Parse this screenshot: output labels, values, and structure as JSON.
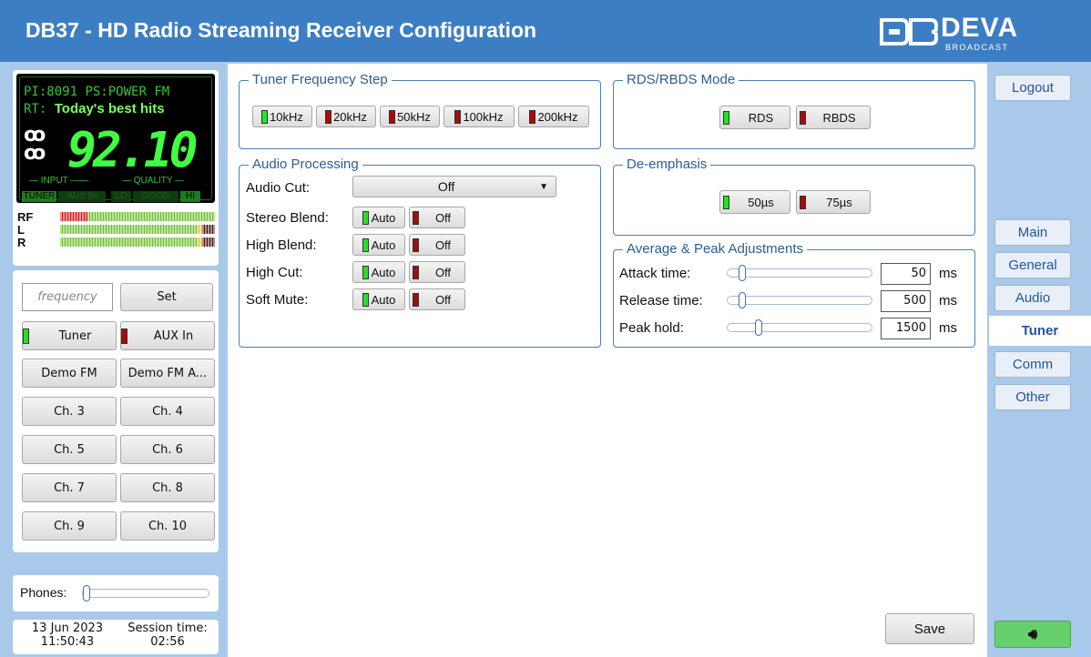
{
  "header": {
    "title": "DB37 - HD Radio Streaming Receiver Configuration",
    "logo_brand": "DEVA",
    "logo_sub": "BROADCAST"
  },
  "display": {
    "pi_label": "PI:",
    "pi_value": "8091",
    "ps_label": "PS:",
    "ps_value": "POWER FM",
    "rt_label": "RT:",
    "rt_value": "Today's best hits",
    "frequency": "92.10",
    "input_label": "INPUT",
    "quality_label": "QUALITY",
    "input_cells": [
      "TUNER",
      "AUX IN"
    ],
    "quality_cells": [
      "LO",
      "GOOD",
      "HI"
    ],
    "meters": [
      "RF",
      "L",
      "R"
    ]
  },
  "left": {
    "frequency_placeholder": "frequency",
    "set_label": "Set",
    "source_tuner": "Tuner",
    "source_aux": "AUX In",
    "presets": [
      "Demo FM",
      "Demo FM A...",
      "Ch. 3",
      "Ch. 4",
      "Ch. 5",
      "Ch. 6",
      "Ch. 7",
      "Ch. 8",
      "Ch. 9",
      "Ch. 10"
    ],
    "phones_label": "Phones:",
    "phones_level": 0.0,
    "date": "13 Jun 2023",
    "time": "11:50:43",
    "session_label": "Session time:",
    "session_time": "02:56"
  },
  "tuner_step": {
    "title": "Tuner Frequency Step",
    "options": [
      "10kHz",
      "20kHz",
      "50kHz",
      "100kHz",
      "200kHz"
    ],
    "selected": "10kHz"
  },
  "rds": {
    "title": "RDS/RBDS Mode",
    "options": [
      "RDS",
      "RBDS"
    ],
    "selected": "RDS"
  },
  "audio_processing": {
    "title": "Audio Processing",
    "audio_cut_label": "Audio Cut:",
    "audio_cut_value": "Off",
    "rows": [
      {
        "label": "Stereo Blend:",
        "auto": "Auto",
        "off": "Off"
      },
      {
        "label": "High Blend:",
        "auto": "Auto",
        "off": "Off"
      },
      {
        "label": "High Cut:",
        "auto": "Auto",
        "off": "Off"
      },
      {
        "label": "Soft Mute:",
        "auto": "Auto",
        "off": "Off"
      }
    ]
  },
  "deemphasis": {
    "title": "De-emphasis",
    "options": [
      "50µs",
      "75µs"
    ],
    "selected": "50µs"
  },
  "peak": {
    "title": "Average & Peak Adjustments",
    "rows": [
      {
        "label": "Attack time:",
        "value": "50",
        "unit": "ms"
      },
      {
        "label": "Release time:",
        "value": "500",
        "unit": "ms"
      },
      {
        "label": "Peak hold:",
        "value": "1500",
        "unit": "ms"
      }
    ]
  },
  "save_label": "Save",
  "nav": {
    "logout": "Logout",
    "tabs": [
      "Main",
      "General",
      "Audio",
      "Tuner",
      "Comm",
      "Other"
    ],
    "active": "Tuner"
  },
  "colors": {
    "header": "#3c7ec4",
    "background": "#a9c9ea",
    "accent": "#1f56a3",
    "led_on": "#24e224",
    "led_off": "#a30d0d"
  }
}
